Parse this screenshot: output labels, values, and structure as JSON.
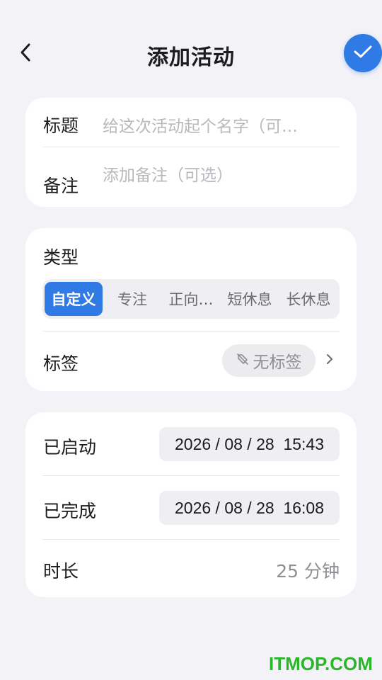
{
  "header": {
    "title": "添加活动",
    "back_icon": "chevron-left-icon",
    "confirm_icon": "check-icon",
    "accent": "#2f7ae5"
  },
  "info_card": {
    "title_label": "标题",
    "title_placeholder": "给这次活动起个名字（可…",
    "note_label": "备注",
    "note_placeholder": "添加备注（可选）"
  },
  "type_card": {
    "type_label": "类型",
    "segments": [
      "自定义",
      "专注",
      "正向…",
      "短休息",
      "长休息"
    ],
    "selected_segment": "自定义",
    "tags_label": "标签",
    "tag_chip": "无标签",
    "tag_chip_icon": "tag-off-icon",
    "chevron_icon": "chevron-right-icon"
  },
  "time_card": {
    "started_label": "已启动",
    "started_value": "2026 / 08 / 28  15:43",
    "completed_label": "已完成",
    "completed_value": "2026 / 08 / 28  16:08",
    "duration_label": "时长",
    "duration_value": "25 分钟"
  },
  "watermark": "ITMOP.COM"
}
